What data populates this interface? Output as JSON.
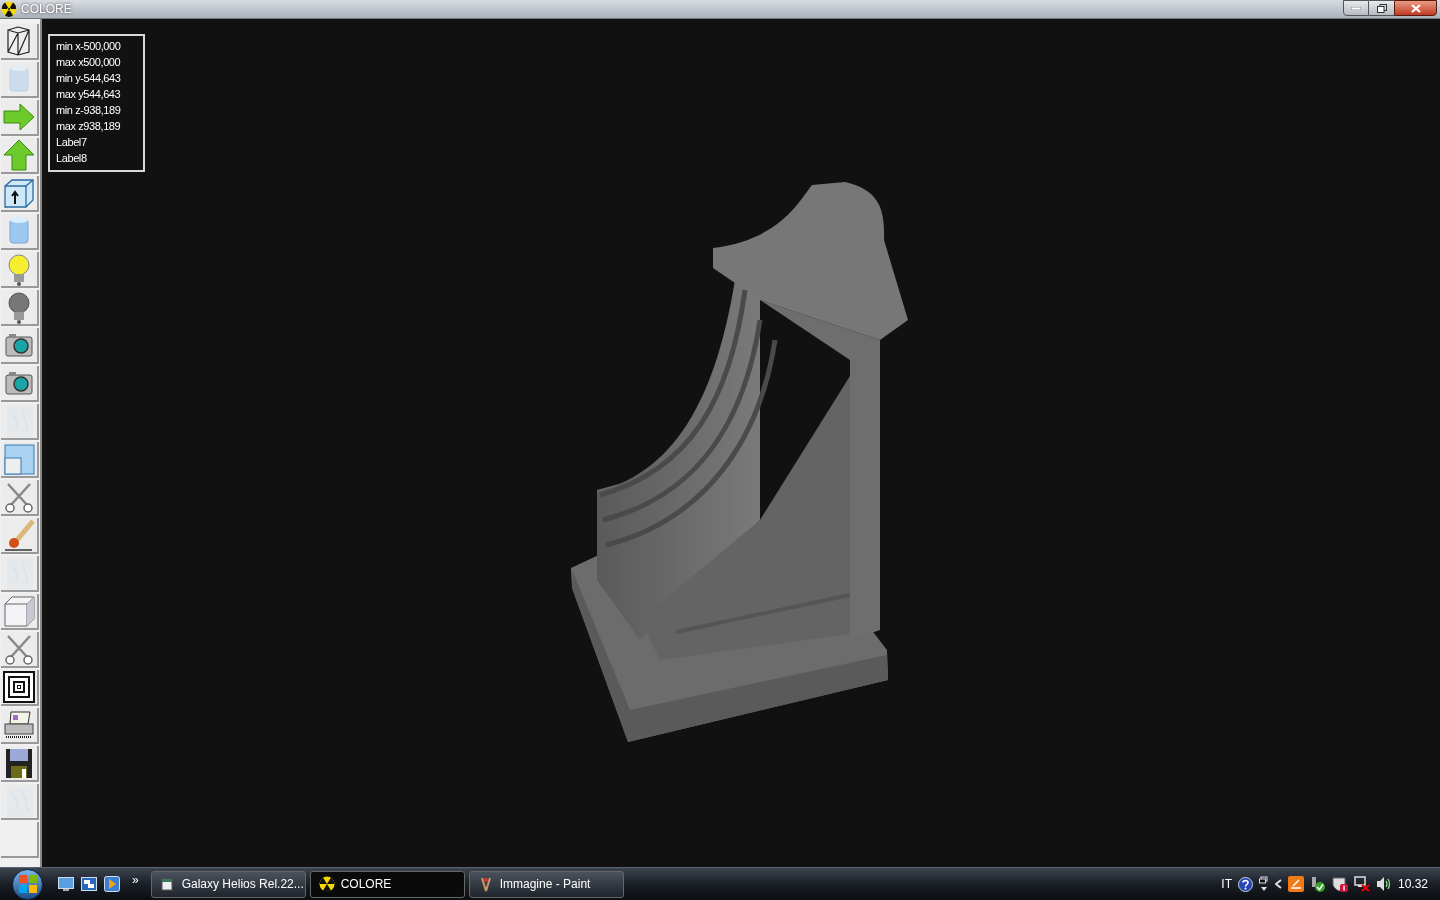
{
  "window": {
    "title": "COLORE"
  },
  "toolbar": [
    {
      "kind": "wireframe",
      "disabled": false
    },
    {
      "kind": "cylinder",
      "disabled": true
    },
    {
      "kind": "arrow-right",
      "disabled": false
    },
    {
      "kind": "arrow-up",
      "disabled": false
    },
    {
      "kind": "cube-arrow",
      "disabled": false
    },
    {
      "kind": "cylinder",
      "disabled": false
    },
    {
      "kind": "bulb-yellow",
      "disabled": false
    },
    {
      "kind": "bulb-gray",
      "disabled": false
    },
    {
      "kind": "camera",
      "disabled": false
    },
    {
      "kind": "camera",
      "disabled": false
    },
    {
      "kind": "texture",
      "disabled": true
    },
    {
      "kind": "panel",
      "disabled": false
    },
    {
      "kind": "scissors",
      "disabled": false
    },
    {
      "kind": "brush",
      "disabled": false
    },
    {
      "kind": "texture",
      "disabled": true
    },
    {
      "kind": "cube",
      "disabled": false
    },
    {
      "kind": "scissors",
      "disabled": false
    },
    {
      "kind": "squares",
      "disabled": false
    },
    {
      "kind": "printer",
      "disabled": false
    },
    {
      "kind": "floppy",
      "disabled": false
    },
    {
      "kind": "texture",
      "disabled": true
    }
  ],
  "info_labels": [
    "min x-500,000",
    "max x500,000",
    "min y-544,643",
    "max y544,643",
    "min z-938,189",
    "max z938,189",
    "Label7",
    "Label8"
  ],
  "taskbar": {
    "overflow": "»",
    "tasks": [
      {
        "label": "Galaxy Helios  Rel.22...",
        "kind": "galaxy",
        "selected": false
      },
      {
        "label": "COLORE",
        "kind": "colore",
        "selected": true
      },
      {
        "label": "Immagine - Paint",
        "kind": "paint",
        "selected": false
      }
    ],
    "language": "IT",
    "clock": "10.32"
  }
}
